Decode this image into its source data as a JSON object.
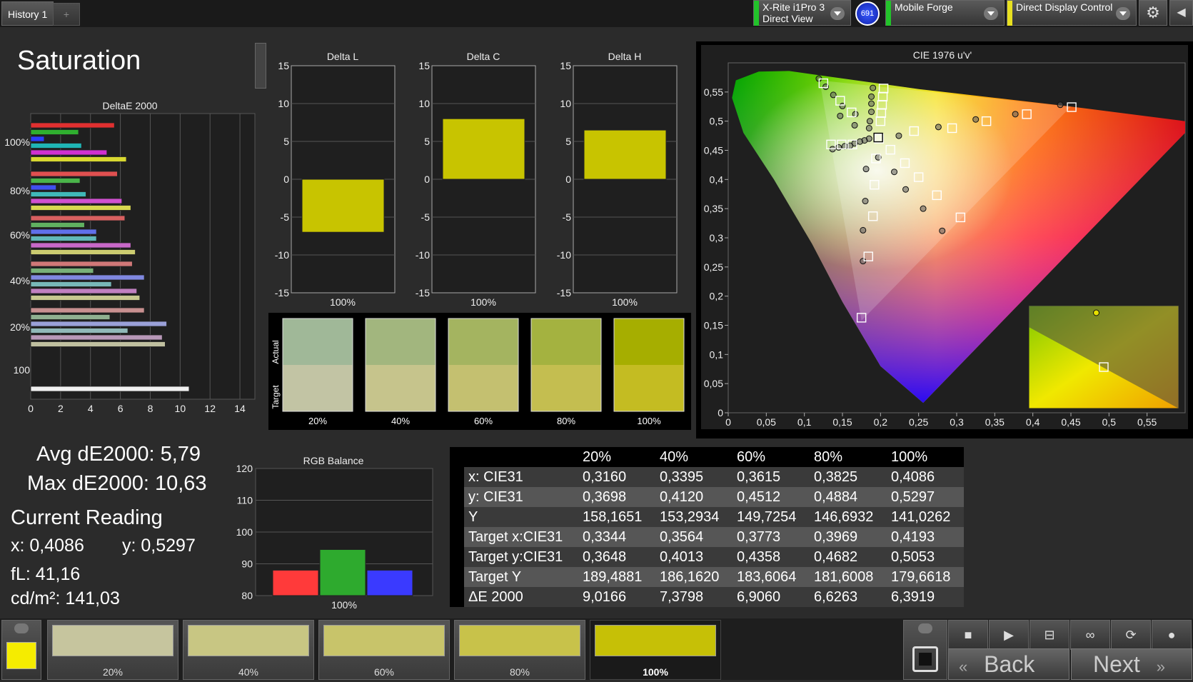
{
  "topbar": {
    "history_tab": "History 1",
    "add_tab": "+",
    "meter": {
      "line1": "X-Rite i1Pro 3",
      "line2": "Direct View",
      "color": "#22c32a"
    },
    "badge": "691",
    "pattern_gen": {
      "label": "Mobile Forge",
      "color": "#22c32a"
    },
    "display_ctl": {
      "label": "Direct Display Control",
      "color": "#e8e020"
    }
  },
  "page_title": "Saturation",
  "icons": {
    "gear": "gear-icon",
    "back": "chevron-left-icon"
  },
  "deltae_chart": {
    "type": "bar",
    "title": "DeltaE 2000",
    "orientation": "horizontal",
    "xlim": [
      0,
      15
    ],
    "x_ticks": [
      "0",
      "2",
      "4",
      "6",
      "8",
      "10",
      "12",
      "14"
    ],
    "groups": [
      {
        "label": "100%",
        "values": [
          5.6,
          3.2,
          0.9,
          3.4,
          5.1,
          6.4
        ],
        "colors": [
          "#e03030",
          "#2faf2f",
          "#2c3cff",
          "#1fb5b5",
          "#d030d0",
          "#d8d830"
        ]
      },
      {
        "label": "80%",
        "values": [
          5.8,
          3.3,
          1.7,
          3.7,
          6.1,
          6.7
        ],
        "colors": [
          "#e05050",
          "#4ab44a",
          "#4050f0",
          "#40b8b8",
          "#d050d0",
          "#d8d850"
        ]
      },
      {
        "label": "60%",
        "values": [
          6.3,
          3.6,
          4.4,
          4.4,
          6.7,
          7.0
        ],
        "colors": [
          "#d86060",
          "#60b060",
          "#6070ea",
          "#60b8b8",
          "#c868c8",
          "#cccc70"
        ]
      },
      {
        "label": "40%",
        "values": [
          6.8,
          4.2,
          7.6,
          5.4,
          7.1,
          7.3
        ],
        "colors": [
          "#d07878",
          "#78b078",
          "#8088e0",
          "#78b8b8",
          "#c080c0",
          "#c8c890"
        ]
      },
      {
        "label": "20%",
        "values": [
          7.6,
          5.3,
          9.1,
          6.5,
          8.8,
          9.0
        ],
        "colors": [
          "#c89090",
          "#90b090",
          "#9aa0d8",
          "#90b8b8",
          "#b898b8",
          "#c0c0a0"
        ]
      },
      {
        "label": "100",
        "values": [
          10.6
        ],
        "colors": [
          "#f0f0f0"
        ]
      }
    ]
  },
  "delta_charts": [
    {
      "title": "Delta L",
      "value": -7.0,
      "category": "100%",
      "ylim": [
        -15,
        15
      ]
    },
    {
      "title": "Delta C",
      "value": 8.0,
      "category": "100%",
      "ylim": [
        -15,
        15
      ]
    },
    {
      "title": "Delta H",
      "value": 6.5,
      "category": "100%",
      "ylim": [
        -15,
        15
      ]
    }
  ],
  "delta_y_ticks": [
    "15",
    "10",
    "5",
    "0",
    "-5",
    "-10",
    "-15"
  ],
  "swatches": {
    "actual_label": "Actual",
    "target_label": "Target",
    "items": [
      {
        "label": "20%",
        "actual": "#a0b898",
        "target": "#c2c4a4"
      },
      {
        "label": "40%",
        "actual": "#a2b67e",
        "target": "#c6c48c"
      },
      {
        "label": "60%",
        "actual": "#a4b460",
        "target": "#c4c070"
      },
      {
        "label": "80%",
        "actual": "#a4b240",
        "target": "#c4be50"
      },
      {
        "label": "100%",
        "actual": "#a6ae00",
        "target": "#c4bc22"
      }
    ]
  },
  "cie_chart": {
    "type": "scatter",
    "title": "CIE 1976 u'v'",
    "xlim": [
      0,
      0.6
    ],
    "ylim": [
      0,
      0.6
    ],
    "x_ticks": [
      "0",
      "0,05",
      "0,1",
      "0,15",
      "0,2",
      "0,25",
      "0,3",
      "0,35",
      "0,4",
      "0,45",
      "0,5",
      "0,55"
    ],
    "y_ticks": [
      "0",
      "0,05",
      "0,1",
      "0,15",
      "0,2",
      "0,25",
      "0,3",
      "0,35",
      "0,4",
      "0,45",
      "0,5",
      "0,55"
    ],
    "targets": [
      [
        0.125,
        0.565
      ],
      [
        0.147,
        0.535
      ],
      [
        0.162,
        0.515
      ],
      [
        0.204,
        0.556
      ],
      [
        0.203,
        0.542
      ],
      [
        0.202,
        0.528
      ],
      [
        0.201,
        0.514
      ],
      [
        0.2,
        0.5
      ],
      [
        0.198,
        0.47
      ],
      [
        0.244,
        0.483
      ],
      [
        0.294,
        0.488
      ],
      [
        0.339,
        0.5
      ],
      [
        0.392,
        0.512
      ],
      [
        0.451,
        0.524
      ],
      [
        0.135,
        0.46
      ],
      [
        0.149,
        0.46
      ],
      [
        0.163,
        0.46
      ],
      [
        0.213,
        0.451
      ],
      [
        0.232,
        0.428
      ],
      [
        0.25,
        0.404
      ],
      [
        0.274,
        0.373
      ],
      [
        0.305,
        0.335
      ],
      [
        0.194,
        0.436
      ],
      [
        0.192,
        0.391
      ],
      [
        0.19,
        0.337
      ],
      [
        0.184,
        0.268
      ],
      [
        0.175,
        0.163
      ],
      [
        0.197,
        0.472
      ]
    ],
    "measured": [
      [
        0.119,
        0.573
      ],
      [
        0.128,
        0.559
      ],
      [
        0.138,
        0.545
      ],
      [
        0.15,
        0.526
      ],
      [
        0.167,
        0.512
      ],
      [
        0.19,
        0.557
      ],
      [
        0.188,
        0.542
      ],
      [
        0.188,
        0.53
      ],
      [
        0.188,
        0.516
      ],
      [
        0.186,
        0.5
      ],
      [
        0.185,
        0.488
      ],
      [
        0.185,
        0.47
      ],
      [
        0.179,
        0.467
      ],
      [
        0.173,
        0.465
      ],
      [
        0.166,
        0.462
      ],
      [
        0.16,
        0.458
      ],
      [
        0.153,
        0.457
      ],
      [
        0.145,
        0.455
      ],
      [
        0.137,
        0.452
      ],
      [
        0.197,
        0.438
      ],
      [
        0.181,
        0.418
      ],
      [
        0.218,
        0.413
      ],
      [
        0.233,
        0.383
      ],
      [
        0.256,
        0.35
      ],
      [
        0.281,
        0.312
      ],
      [
        0.18,
        0.363
      ],
      [
        0.177,
        0.313
      ],
      [
        0.177,
        0.26
      ],
      [
        0.224,
        0.475
      ],
      [
        0.276,
        0.49
      ],
      [
        0.325,
        0.503
      ],
      [
        0.377,
        0.512
      ],
      [
        0.436,
        0.528
      ],
      [
        0.147,
        0.509
      ],
      [
        0.166,
        0.493
      ]
    ],
    "inset": {
      "target": [
        0.5,
        0.5
      ],
      "measured": [
        0.45,
        0.75
      ]
    }
  },
  "stats": {
    "avg": "Avg dE2000: 5,79",
    "max": "Max dE2000: 10,63"
  },
  "current_reading": {
    "title": "Current Reading",
    "x": "x: 0,4086",
    "y": "y: 0,5297",
    "fl": "fL: 41,16",
    "cdm2": "cd/m²: 141,03"
  },
  "rgb_chart": {
    "type": "bar",
    "title": "RGB Balance",
    "category": "100%",
    "ylim": [
      80,
      120
    ],
    "y_ticks": [
      "120",
      "110",
      "100",
      "90",
      "80"
    ],
    "values": [
      88,
      94.5,
      88
    ],
    "colors": [
      "#ff3a3a",
      "#2eaa2e",
      "#3a3aff"
    ]
  },
  "table": {
    "columns": [
      "20%",
      "40%",
      "60%",
      "80%",
      "100%"
    ],
    "rows": [
      {
        "label": "x: CIE31",
        "values": [
          "0,3160",
          "0,3395",
          "0,3615",
          "0,3825",
          "0,4086"
        ]
      },
      {
        "label": "y: CIE31",
        "values": [
          "0,3698",
          "0,4120",
          "0,4512",
          "0,4884",
          "0,5297"
        ]
      },
      {
        "label": "Y",
        "values": [
          "158,1651",
          "153,2934",
          "149,7254",
          "146,6932",
          "141,0262"
        ]
      },
      {
        "label": "Target x:CIE31",
        "values": [
          "0,3344",
          "0,3564",
          "0,3773",
          "0,3969",
          "0,4193"
        ]
      },
      {
        "label": "Target y:CIE31",
        "values": [
          "0,3648",
          "0,4013",
          "0,4358",
          "0,4682",
          "0,5053"
        ]
      },
      {
        "label": "Target Y",
        "values": [
          "189,4881",
          "186,1620",
          "183,6064",
          "181,6008",
          "179,6618"
        ]
      },
      {
        "label": "ΔE 2000",
        "values": [
          "9,0166",
          "7,3798",
          "6,9060",
          "6,6263",
          "6,3919"
        ]
      }
    ]
  },
  "bottom": {
    "current_color": "#f5ec00",
    "patches": [
      {
        "label": "20%",
        "color": "#c6c59e"
      },
      {
        "label": "40%",
        "color": "#c8c683"
      },
      {
        "label": "60%",
        "color": "#c8c46a"
      },
      {
        "label": "80%",
        "color": "#c8c24a"
      },
      {
        "label": "100%",
        "color": "#c6c006"
      }
    ],
    "back_label": "Back",
    "next_label": "Next"
  }
}
